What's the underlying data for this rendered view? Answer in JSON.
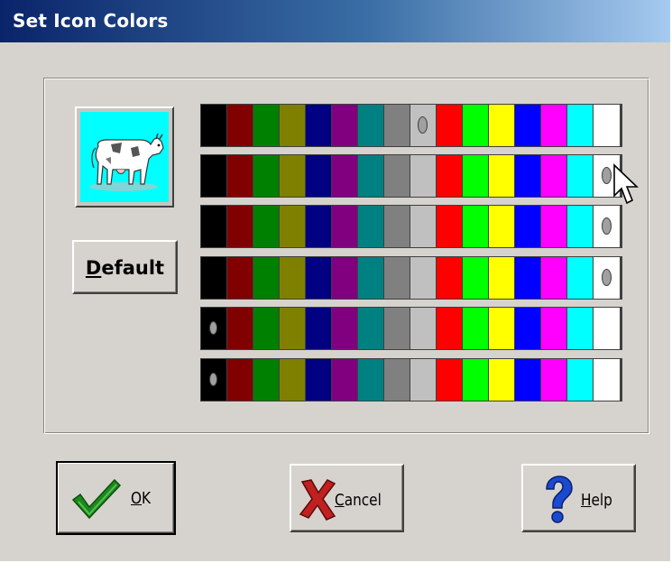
{
  "window": {
    "title": "Set Icon Colors"
  },
  "preview": {
    "icon": "cow-icon"
  },
  "buttons": {
    "default_label": "Default",
    "ok_label": "OK",
    "cancel_label": "Cancel",
    "help_label": "Help"
  },
  "palette": {
    "colors": [
      "#000000",
      "#800000",
      "#008000",
      "#808000",
      "#000080",
      "#800080",
      "#008080",
      "#808080",
      "#c0c0c0",
      "#ff0000",
      "#00ff00",
      "#ffff00",
      "#0000ff",
      "#ff00ff",
      "#00ffff",
      "#ffffff"
    ],
    "selected_index_per_row": [
      8,
      15,
      15,
      15,
      0,
      0
    ]
  },
  "colors": {
    "title_start": "#0a246a",
    "title_end": "#a6caf0",
    "face": "#d6d3ce",
    "accent_check": "#1a8a1a",
    "accent_x": "#c02020",
    "accent_help": "#1a4ad0"
  }
}
